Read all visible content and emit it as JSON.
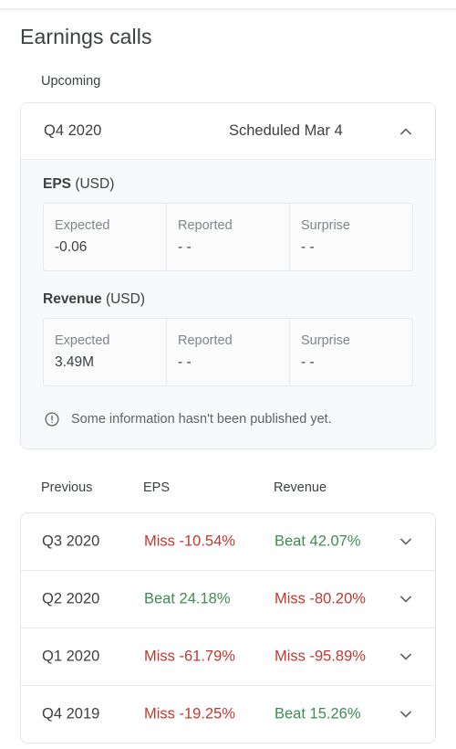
{
  "page": {
    "title": "Earnings calls"
  },
  "upcoming": {
    "section_label": "Upcoming",
    "quarter": "Q4 2020",
    "status": "Scheduled Mar 4",
    "toggle_icon": "chevron-up-icon",
    "expanded": true,
    "metrics": [
      {
        "name": "EPS",
        "unit": "(USD)",
        "cells": [
          {
            "label": "Expected",
            "value": "-0.06"
          },
          {
            "label": "Reported",
            "value": "- -"
          },
          {
            "label": "Surprise",
            "value": "- -"
          }
        ]
      },
      {
        "name": "Revenue",
        "unit": "(USD)",
        "cells": [
          {
            "label": "Expected",
            "value": "3.49M"
          },
          {
            "label": "Reported",
            "value": "- -"
          },
          {
            "label": "Surprise",
            "value": "- -"
          }
        ]
      }
    ],
    "notice": {
      "icon": "error-outline-icon",
      "text": "Some information hasn't been published yet."
    }
  },
  "previous": {
    "columns": [
      "Previous",
      "EPS",
      "Revenue"
    ],
    "rows": [
      {
        "quarter": "Q3 2020",
        "eps": "Miss -10.54%",
        "eps_type": "miss",
        "revenue": "Beat 42.07%",
        "revenue_type": "beat",
        "toggle_icon": "chevron-down-icon"
      },
      {
        "quarter": "Q2 2020",
        "eps": "Beat 24.18%",
        "eps_type": "beat",
        "revenue": "Miss -80.20%",
        "revenue_type": "miss",
        "toggle_icon": "chevron-down-icon"
      },
      {
        "quarter": "Q1 2020",
        "eps": "Miss -61.79%",
        "eps_type": "miss",
        "revenue": "Miss -95.89%",
        "revenue_type": "miss",
        "toggle_icon": "chevron-down-icon"
      },
      {
        "quarter": "Q4 2019",
        "eps": "Miss -19.25%",
        "eps_type": "miss",
        "revenue": "Beat 15.26%",
        "revenue_type": "beat",
        "toggle_icon": "chevron-down-icon"
      }
    ]
  },
  "colors": {
    "miss": "#c0392f",
    "beat": "#3d8c53",
    "text_primary": "#3c4043",
    "text_secondary": "#80868b",
    "card_bg": "#f8f9fa",
    "border": "#e4e6e9"
  }
}
